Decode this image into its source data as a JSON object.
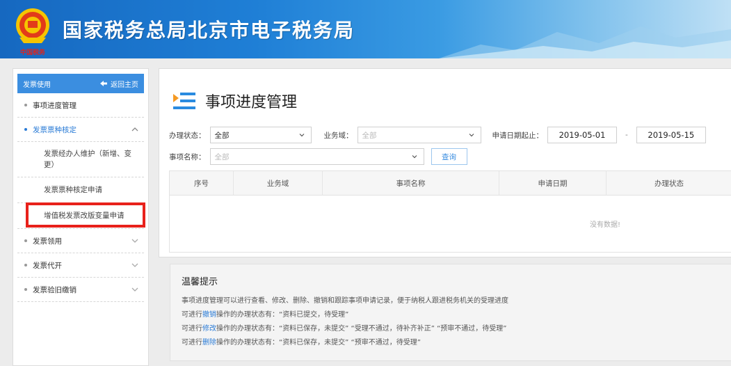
{
  "header": {
    "title": "国家税务总局北京市电子税务局",
    "emblem_caption": "中国税务"
  },
  "sidebar": {
    "head_label": "发票使用",
    "back_label": "返回主页",
    "menu": [
      {
        "label": "事项进度管理"
      },
      {
        "label": "发票票种核定",
        "expanded": true
      },
      {
        "label": "发票领用"
      },
      {
        "label": "发票代开"
      },
      {
        "label": "发票验旧缴销"
      }
    ],
    "submenu": [
      {
        "label": "发票经办人维护（新增、变更）"
      },
      {
        "label": "发票票种核定申请"
      },
      {
        "label": "增值税发票改版变量申请"
      }
    ]
  },
  "main": {
    "title": "事项进度管理",
    "form": {
      "status_label": "办理状态：",
      "status_value": "全部",
      "domain_label": "业务域：",
      "domain_placeholder": "全部",
      "date_label": "申请日期起止：",
      "date_from": "2019-05-01",
      "date_sep": "-",
      "date_to": "2019-05-15",
      "item_label": "事项名称：",
      "item_placeholder": "全部",
      "query_label": "查询"
    },
    "table": {
      "columns": [
        "序号",
        "业务域",
        "事项名称",
        "申请日期",
        "办理状态"
      ],
      "empty_text": "没有数据!"
    }
  },
  "tips": {
    "title": "温馨提示",
    "line1": "事项进度管理可以进行查看、修改、删除、撤销和跟踪事项申请记录，便于纳税人跟进税务机关的受理进度",
    "line2_a": "可进行",
    "line2_kw": "撤销",
    "line2_b": "操作的办理状态有：“资料已提交，待受理”",
    "line3_a": "可进行",
    "line3_kw": "修改",
    "line3_b": "操作的办理状态有：“资料已保存，未提交”  “受理不通过，待补齐补正”  “预审不通过，待受理”",
    "line4_a": "可进行",
    "line4_kw": "删除",
    "line4_b": "操作的办理状态有：“资料已保存，未提交”  “预审不通过，待受理”"
  },
  "colors": {
    "header_blue": "#1f7fd6",
    "accent": "#3b8ee0",
    "highlight_red": "#e8211b"
  },
  "icons": [
    "tax-emblem-icon",
    "back-arrow-icon",
    "chevron-up-icon",
    "chevron-down-icon",
    "list-title-icon",
    "caret-down-icon"
  ]
}
